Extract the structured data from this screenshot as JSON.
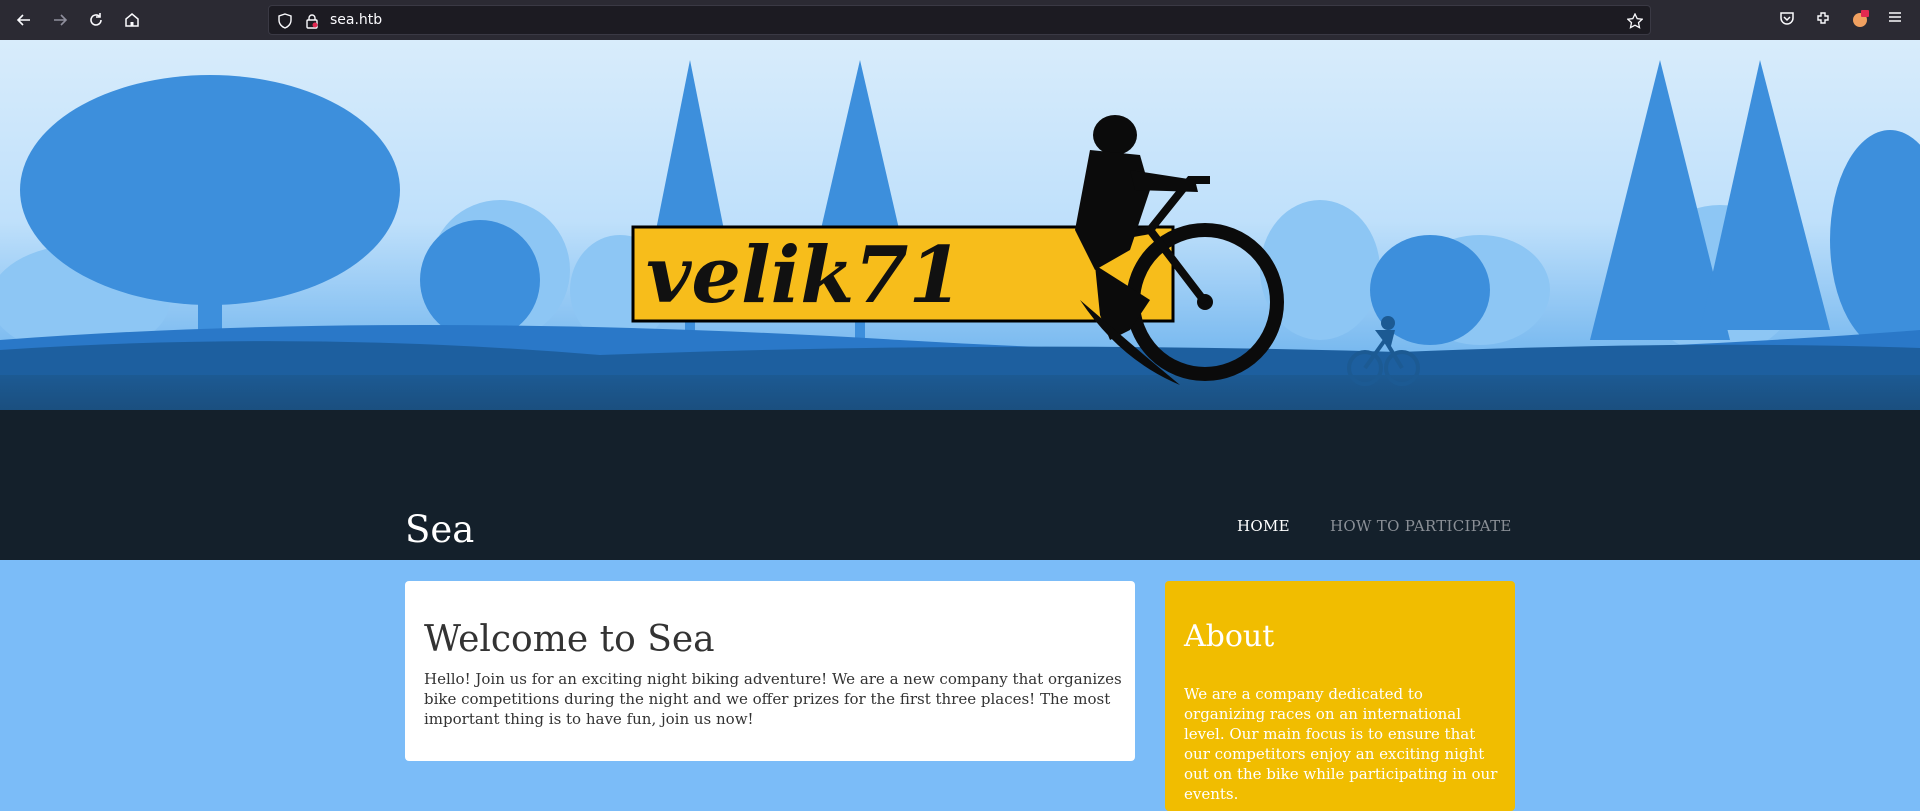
{
  "browser": {
    "url": "sea.htb",
    "icons": [
      "back-icon",
      "forward-icon",
      "reload-icon",
      "home-icon",
      "shield-icon",
      "lock-icon",
      "bookmark-star-icon",
      "pocket-icon",
      "extensions-icon",
      "profile-icon",
      "menu-icon"
    ]
  },
  "hero": {
    "logo_text": "velik71"
  },
  "site": {
    "title": "Sea",
    "nav": {
      "home": "HOME",
      "participate": "HOW TO PARTICIPATE"
    }
  },
  "welcome": {
    "heading": "Welcome to Sea",
    "body": "Hello! Join us for an exciting night biking adventure! We are a new company that organizes bike competitions during the night and we offer prizes for the first three places! The most important thing is to have fun, join us now!"
  },
  "about": {
    "heading": "About",
    "body": "We are a company dedicated to organizing races on an international level. Our main focus is to ensure that our competitors enjoy an exciting night out on the bike while participating in our events."
  },
  "colors": {
    "chrome": "#2b2a33",
    "page_background": "#7bbcf8",
    "hero_dark": "#14202b",
    "about_card": "#f1bd00",
    "logo_yellow": "#f7bd1b"
  }
}
